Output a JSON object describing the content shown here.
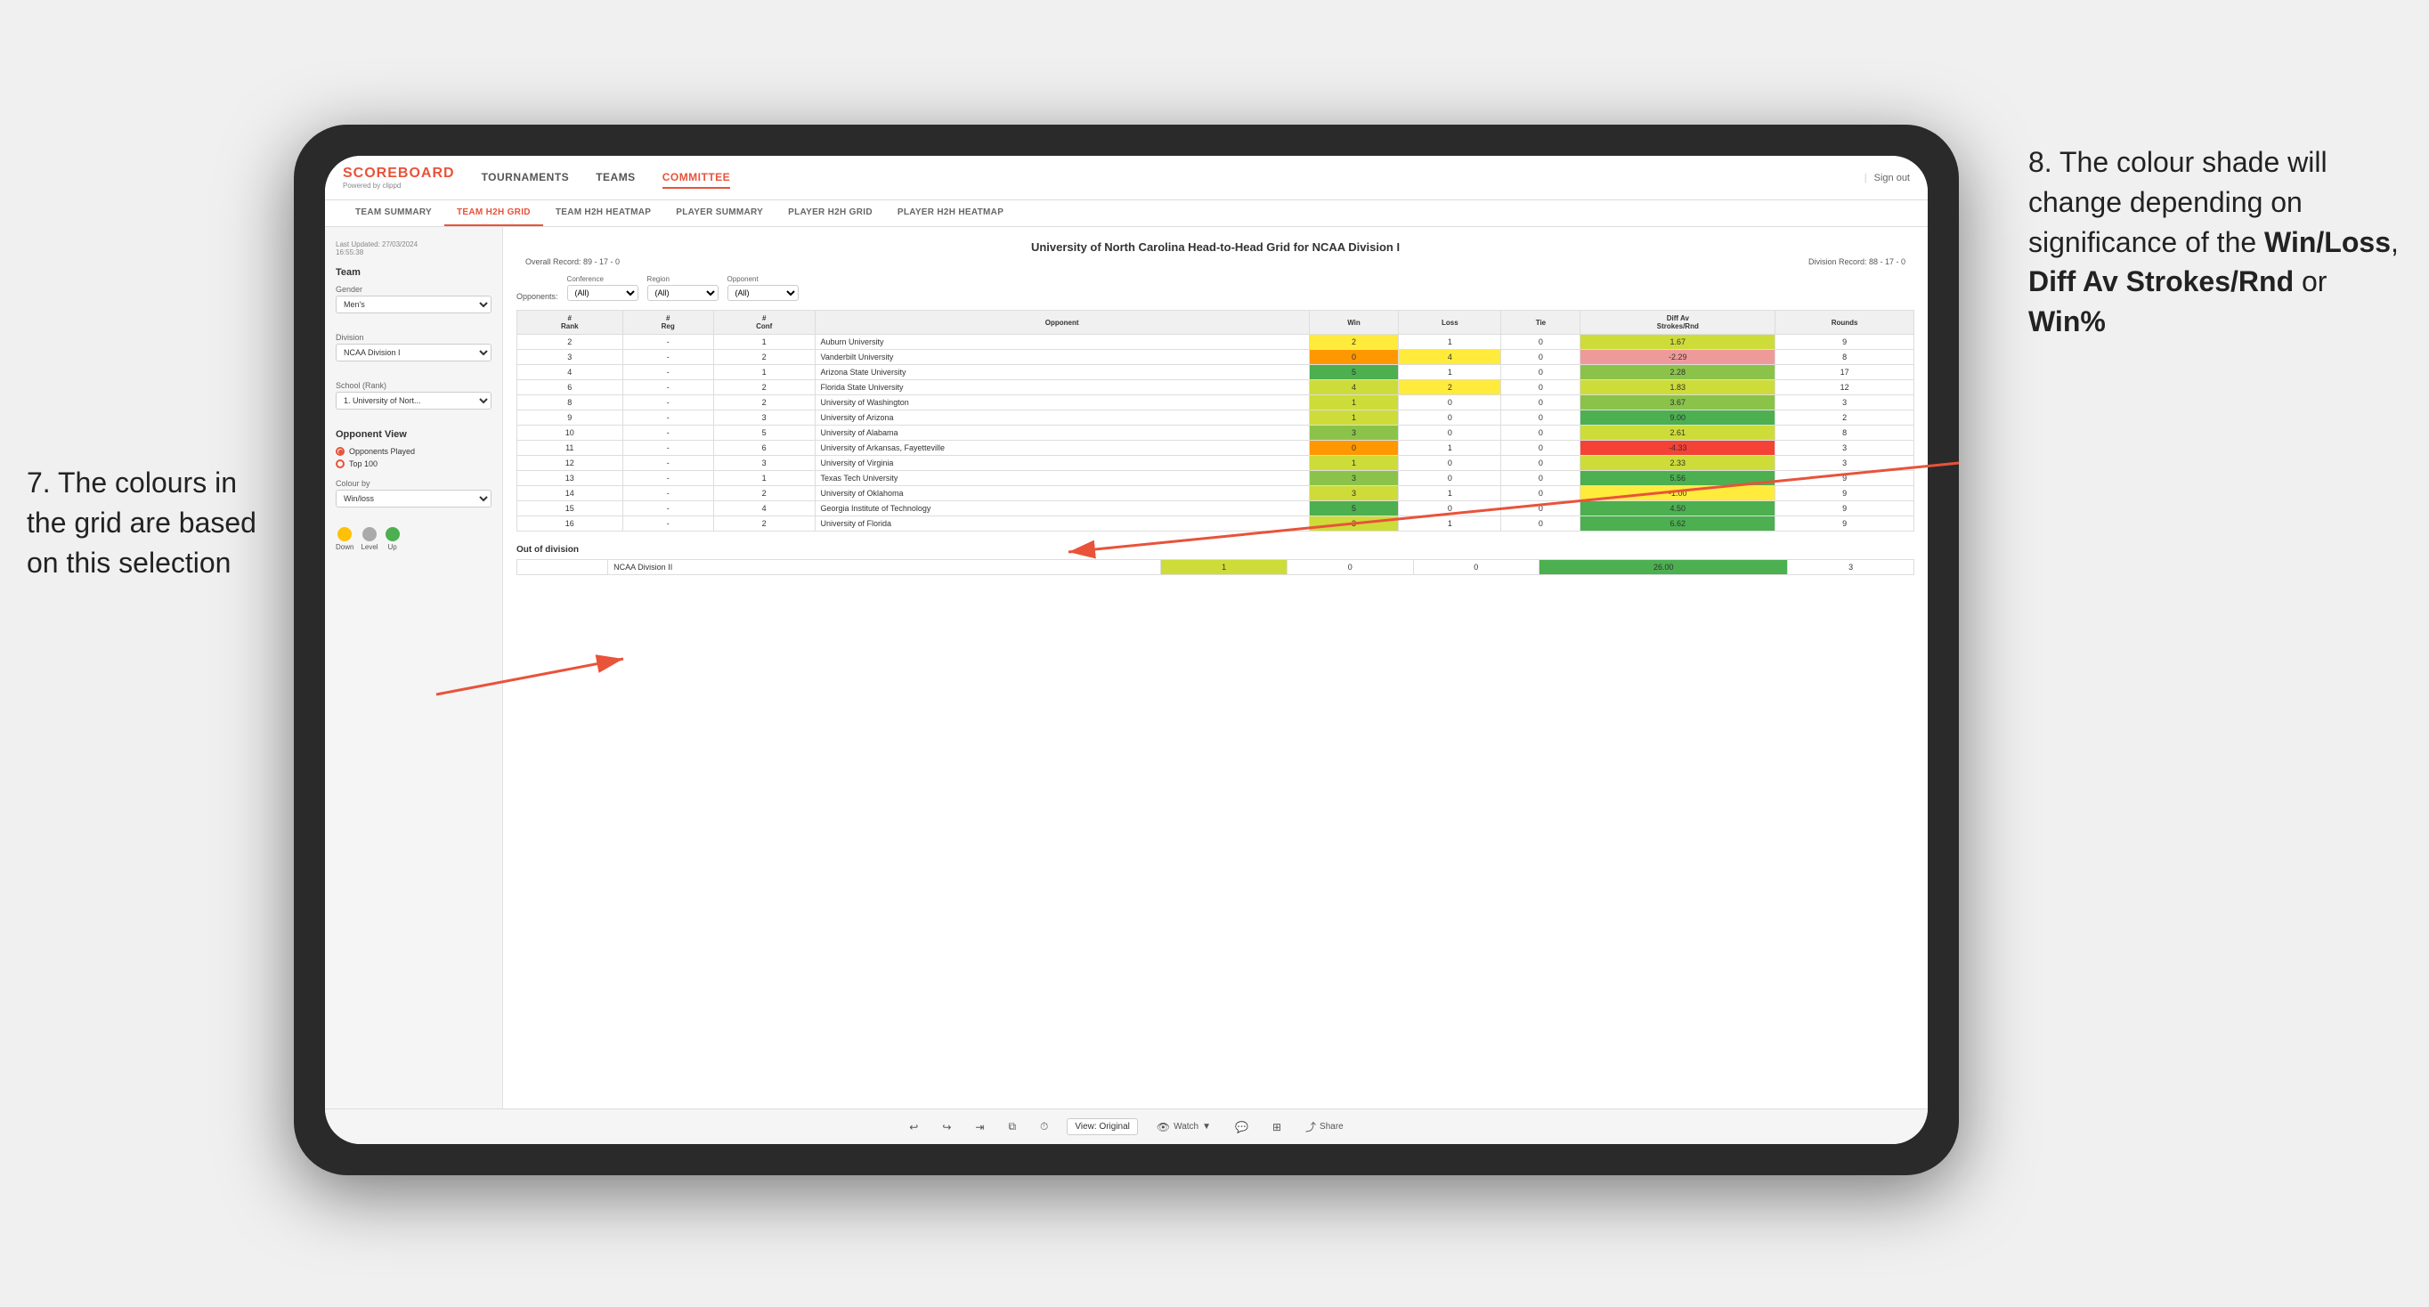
{
  "annotations": {
    "left_text": "7. The colours in the grid are based on this selection",
    "right_text_1": "8. The colour shade will change depending on significance of the ",
    "right_bold_1": "Win/Loss",
    "right_text_2": ", ",
    "right_bold_2": "Diff Av Strokes/Rnd",
    "right_text_3": " or ",
    "right_bold_3": "Win%"
  },
  "app": {
    "logo": "SCOREBOARD",
    "logo_sub": "Powered by clippd",
    "sign_out": "Sign out",
    "nav_items": [
      "TOURNAMENTS",
      "TEAMS",
      "COMMITTEE"
    ],
    "sub_nav_items": [
      "TEAM SUMMARY",
      "TEAM H2H GRID",
      "TEAM H2H HEATMAP",
      "PLAYER SUMMARY",
      "PLAYER H2H GRID",
      "PLAYER H2H HEATMAP"
    ],
    "active_nav": "COMMITTEE",
    "active_sub_nav": "TEAM H2H GRID"
  },
  "sidebar": {
    "timestamp": "Last Updated: 27/03/2024\n16:55:38",
    "team_label": "Team",
    "gender_label": "Gender",
    "gender_value": "Men's",
    "division_label": "Division",
    "division_value": "NCAA Division I",
    "school_label": "School (Rank)",
    "school_value": "1. University of Nort...",
    "opponent_view_label": "Opponent View",
    "radio_options": [
      "Opponents Played",
      "Top 100"
    ],
    "active_radio": "Opponents Played",
    "colour_by_label": "Colour by",
    "colour_by_value": "Win/loss",
    "colours": [
      {
        "label": "Down",
        "color": "#ffc107"
      },
      {
        "label": "Level",
        "color": "#aaaaaa"
      },
      {
        "label": "Up",
        "color": "#4caf50"
      }
    ]
  },
  "grid": {
    "title": "University of North Carolina Head-to-Head Grid for NCAA Division I",
    "overall_record": "Overall Record: 89 - 17 - 0",
    "division_record": "Division Record: 88 - 17 - 0",
    "filters": {
      "opponents_label": "Opponents:",
      "opponents_value": "(All)",
      "conference_label": "Conference",
      "conference_value": "(All)",
      "region_label": "Region",
      "region_value": "(All)",
      "opponent_label": "Opponent",
      "opponent_value": "(All)"
    },
    "columns": [
      "#\nRank",
      "#\nReg",
      "#\nConf",
      "Opponent",
      "Win",
      "Loss",
      "Tie",
      "Diff Av\nStrokes/Rnd",
      "Rounds"
    ],
    "rows": [
      {
        "rank": "2",
        "reg": "-",
        "conf": "1",
        "opponent": "Auburn University",
        "win": "2",
        "loss": "1",
        "tie": "0",
        "diff": "1.67",
        "rounds": "9",
        "win_color": "cell-yellow",
        "loss_color": "cell-white",
        "diff_color": "cell-green-light"
      },
      {
        "rank": "3",
        "reg": "-",
        "conf": "2",
        "opponent": "Vanderbilt University",
        "win": "0",
        "loss": "4",
        "tie": "0",
        "diff": "-2.29",
        "rounds": "8",
        "win_color": "cell-orange",
        "loss_color": "cell-yellow",
        "diff_color": "cell-red-light"
      },
      {
        "rank": "4",
        "reg": "-",
        "conf": "1",
        "opponent": "Arizona State University",
        "win": "5",
        "loss": "1",
        "tie": "0",
        "diff": "2.28",
        "rounds": "17",
        "win_color": "cell-green-dark",
        "loss_color": "cell-white",
        "diff_color": "cell-green-mid"
      },
      {
        "rank": "6",
        "reg": "-",
        "conf": "2",
        "opponent": "Florida State University",
        "win": "4",
        "loss": "2",
        "tie": "0",
        "diff": "1.83",
        "rounds": "12",
        "win_color": "cell-green-light",
        "loss_color": "cell-yellow",
        "diff_color": "cell-green-light"
      },
      {
        "rank": "8",
        "reg": "-",
        "conf": "2",
        "opponent": "University of Washington",
        "win": "1",
        "loss": "0",
        "tie": "0",
        "diff": "3.67",
        "rounds": "3",
        "win_color": "cell-green-light",
        "loss_color": "cell-white",
        "diff_color": "cell-green-mid"
      },
      {
        "rank": "9",
        "reg": "-",
        "conf": "3",
        "opponent": "University of Arizona",
        "win": "1",
        "loss": "0",
        "tie": "0",
        "diff": "9.00",
        "rounds": "2",
        "win_color": "cell-green-light",
        "loss_color": "cell-white",
        "diff_color": "cell-green-dark"
      },
      {
        "rank": "10",
        "reg": "-",
        "conf": "5",
        "opponent": "University of Alabama",
        "win": "3",
        "loss": "0",
        "tie": "0",
        "diff": "2.61",
        "rounds": "8",
        "win_color": "cell-green-mid",
        "loss_color": "cell-white",
        "diff_color": "cell-green-light"
      },
      {
        "rank": "11",
        "reg": "-",
        "conf": "6",
        "opponent": "University of Arkansas, Fayetteville",
        "win": "0",
        "loss": "1",
        "tie": "0",
        "diff": "-4.33",
        "rounds": "3",
        "win_color": "cell-orange",
        "loss_color": "cell-white",
        "diff_color": "cell-red"
      },
      {
        "rank": "12",
        "reg": "-",
        "conf": "3",
        "opponent": "University of Virginia",
        "win": "1",
        "loss": "0",
        "tie": "0",
        "diff": "2.33",
        "rounds": "3",
        "win_color": "cell-green-light",
        "loss_color": "cell-white",
        "diff_color": "cell-green-light"
      },
      {
        "rank": "13",
        "reg": "-",
        "conf": "1",
        "opponent": "Texas Tech University",
        "win": "3",
        "loss": "0",
        "tie": "0",
        "diff": "5.56",
        "rounds": "9",
        "win_color": "cell-green-mid",
        "loss_color": "cell-white",
        "diff_color": "cell-green-dark"
      },
      {
        "rank": "14",
        "reg": "-",
        "conf": "2",
        "opponent": "University of Oklahoma",
        "win": "3",
        "loss": "1",
        "tie": "0",
        "diff": "-1.00",
        "rounds": "9",
        "win_color": "cell-green-light",
        "loss_color": "cell-white",
        "diff_color": "cell-yellow"
      },
      {
        "rank": "15",
        "reg": "-",
        "conf": "4",
        "opponent": "Georgia Institute of Technology",
        "win": "5",
        "loss": "0",
        "tie": "0",
        "diff": "4.50",
        "rounds": "9",
        "win_color": "cell-green-dark",
        "loss_color": "cell-white",
        "diff_color": "cell-green-dark"
      },
      {
        "rank": "16",
        "reg": "-",
        "conf": "2",
        "opponent": "University of Florida",
        "win": "3",
        "loss": "1",
        "tie": "0",
        "diff": "6.62",
        "rounds": "9",
        "win_color": "cell-green-light",
        "loss_color": "cell-white",
        "diff_color": "cell-green-dark"
      }
    ],
    "out_of_division_label": "Out of division",
    "out_of_division_row": {
      "name": "NCAA Division II",
      "win": "1",
      "loss": "0",
      "tie": "0",
      "diff": "26.00",
      "rounds": "3",
      "diff_color": "cell-green-dark"
    }
  },
  "toolbar": {
    "view_label": "View: Original",
    "watch_label": "Watch",
    "share_label": "Share"
  }
}
